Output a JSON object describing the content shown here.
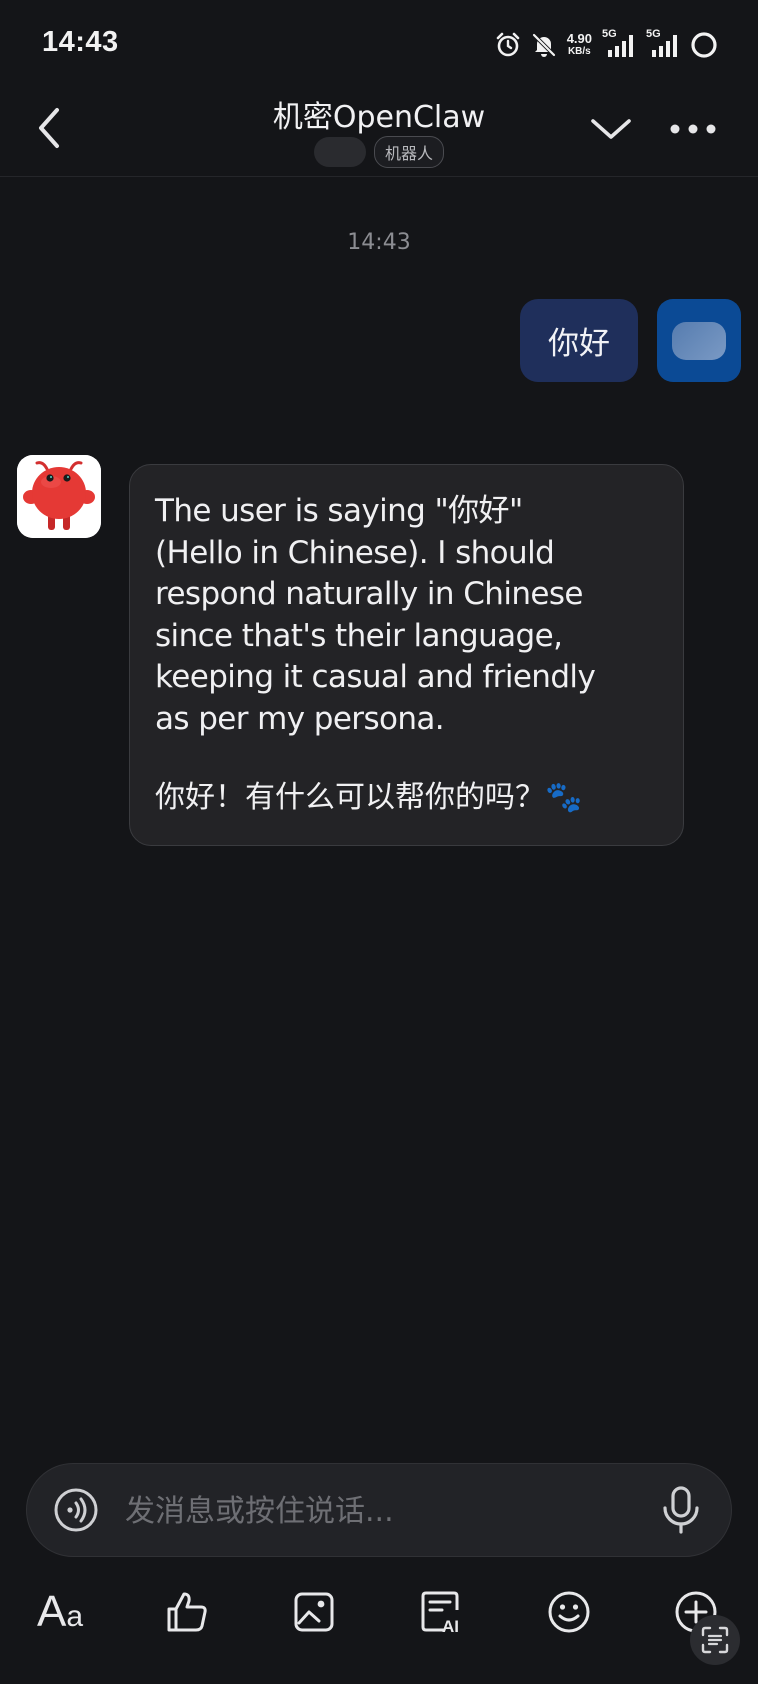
{
  "status_bar": {
    "time": "14:43",
    "net_speed_value": "4.90",
    "net_speed_unit": "KB/s",
    "sim1_label": "5G",
    "sim2_label": "5G",
    "icons": [
      "alarm-icon",
      "mute-bell-icon",
      "signal-icon",
      "signal-icon",
      "battery-ring-icon"
    ]
  },
  "header": {
    "title": "机密OpenClaw",
    "badge": "机器人"
  },
  "chat": {
    "timestamp": "14:43",
    "messages": [
      {
        "direction": "outgoing",
        "text": "你好"
      },
      {
        "direction": "incoming",
        "reasoning": "The user is saying \"你好\"\n(Hello in Chinese). I should\nrespond naturally in Chinese\nsince that's their language,\nkeeping it casual and friendly\nas per my persona.",
        "reply": "你好！有什么可以帮你的吗？🐾"
      }
    ]
  },
  "composer": {
    "placeholder": "发消息或按住说话..."
  },
  "toolbar": {
    "font_label_big": "A",
    "font_label_small": "a",
    "ai_label": "AI"
  },
  "colors": {
    "background": "#141518",
    "outgoing_bubble": "#1f2f5b",
    "incoming_bubble": "#232326",
    "my_avatar_bg": "#0b4a95",
    "bot_avatar_red": "#e53935"
  }
}
